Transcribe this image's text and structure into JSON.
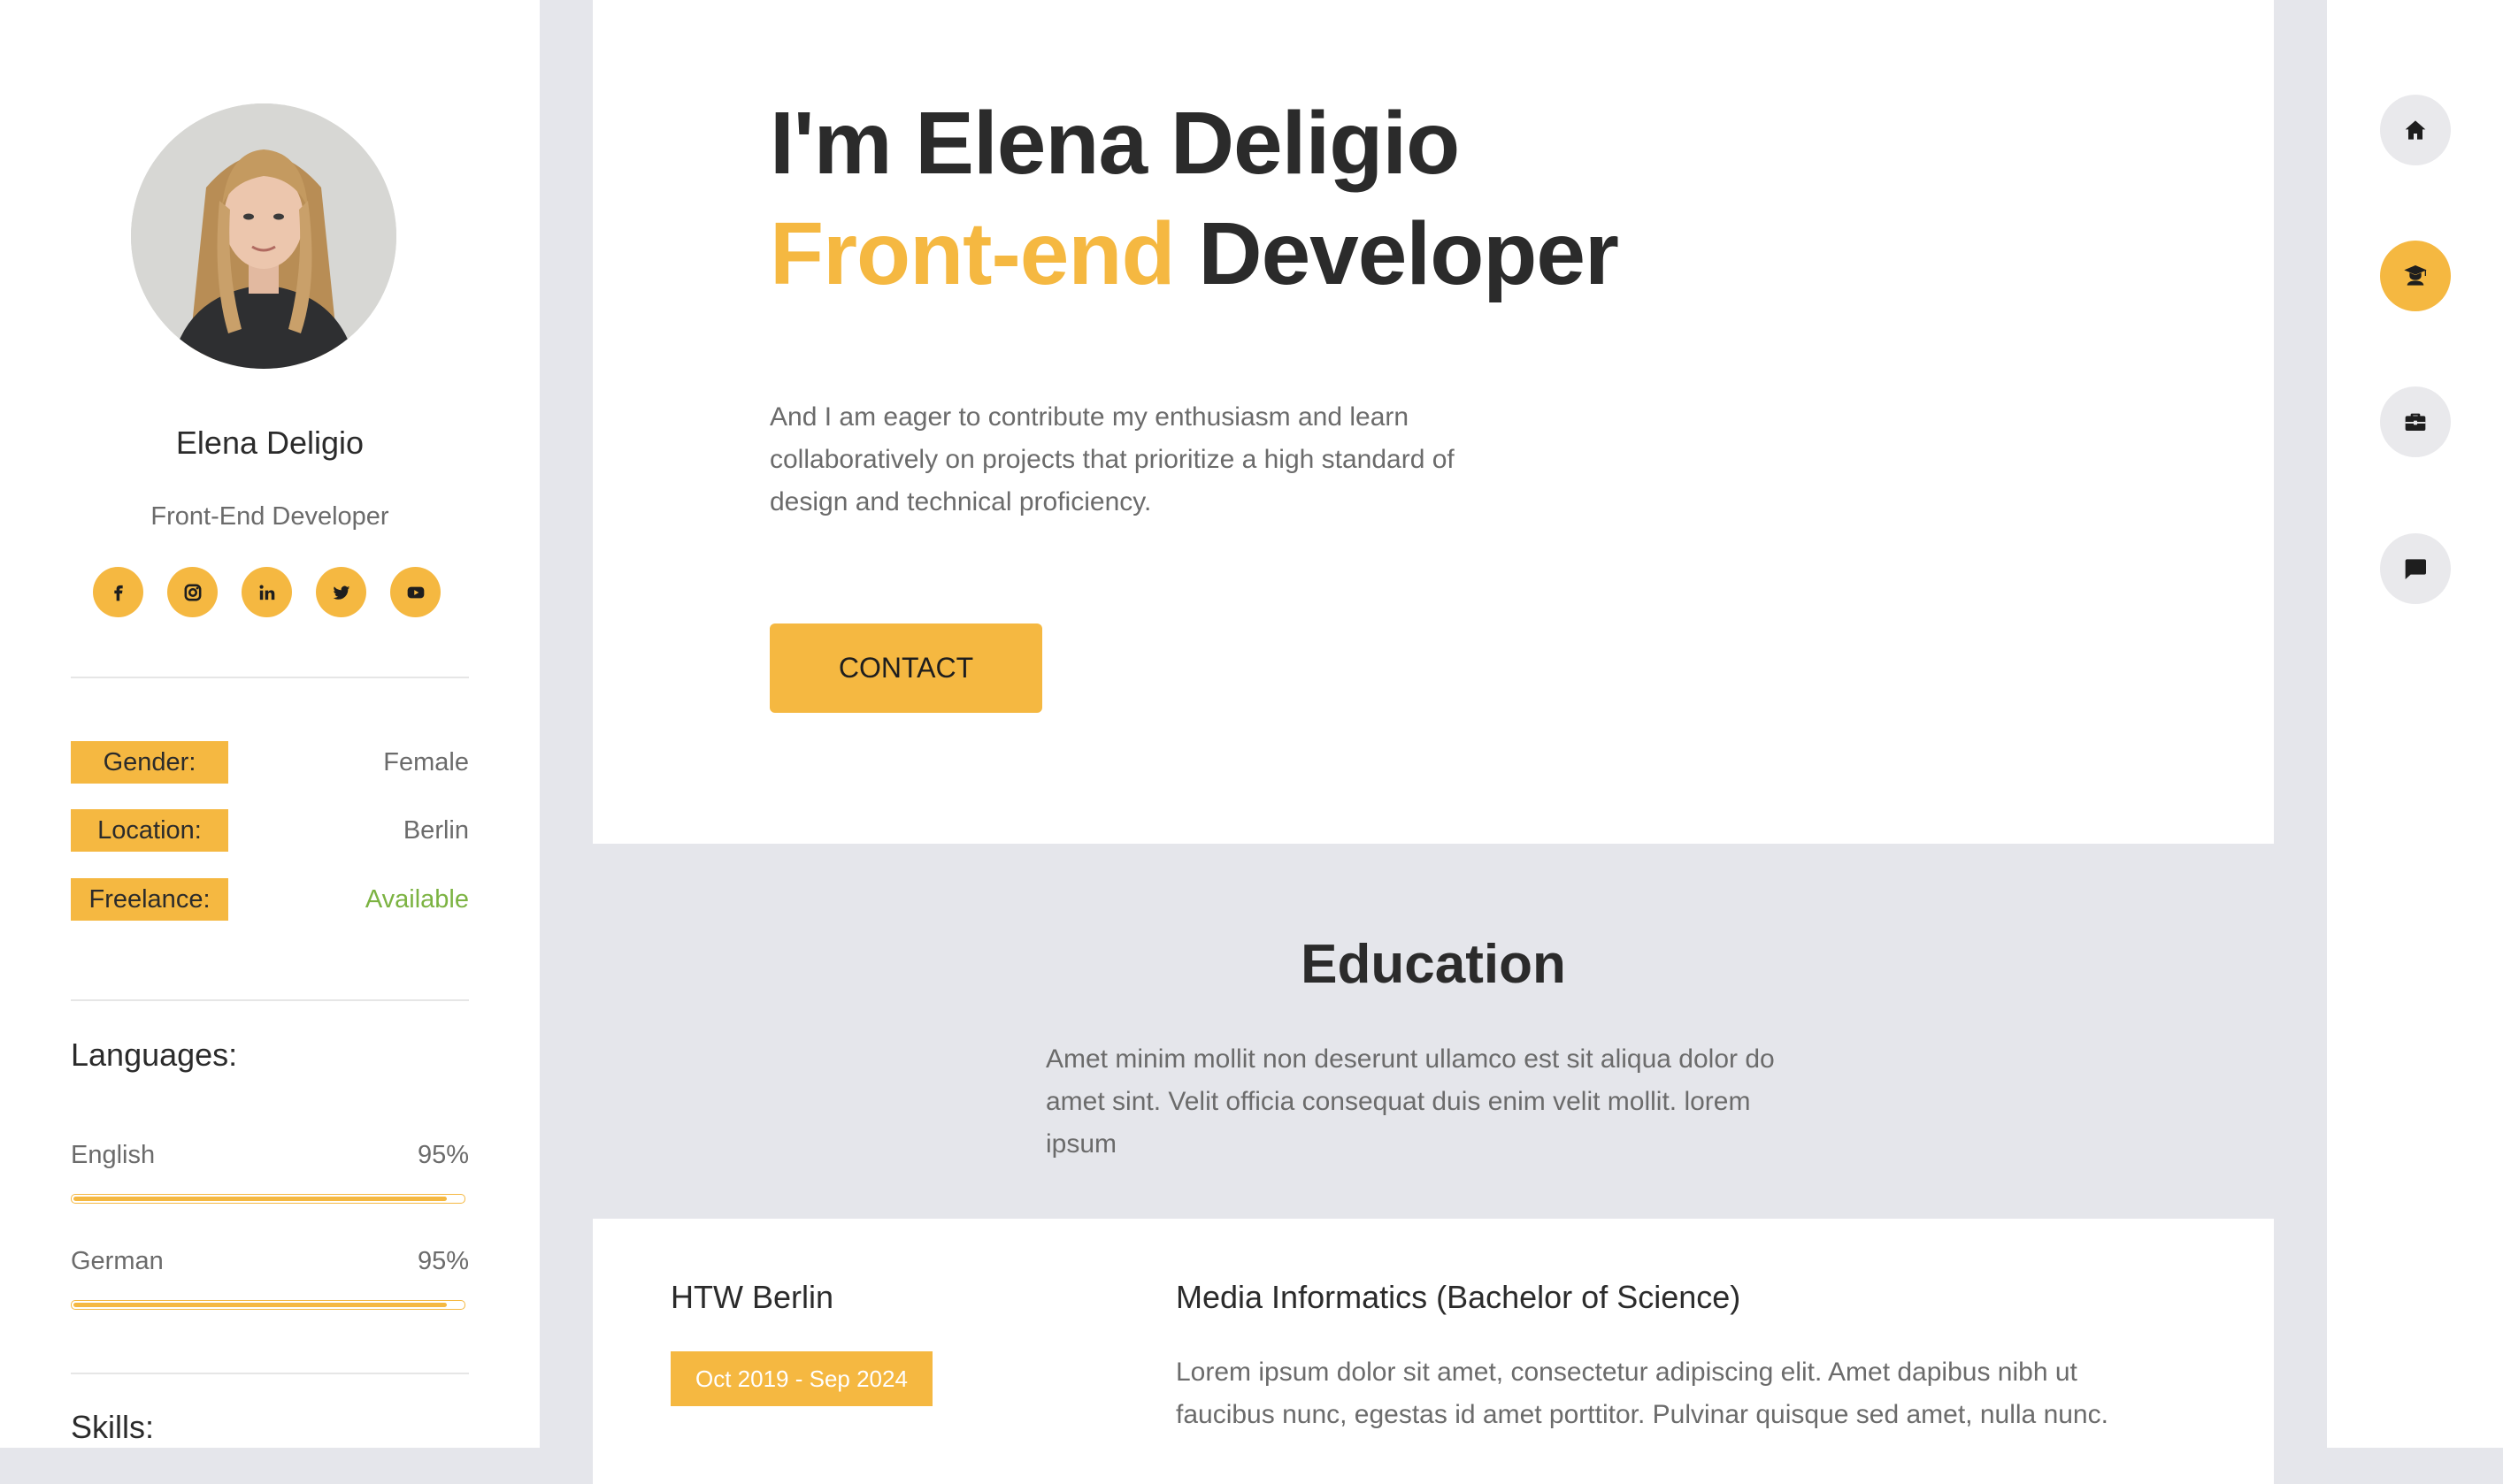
{
  "profile": {
    "name": "Elena Deligio",
    "role": "Front-End Developer",
    "socials": [
      {
        "icon": "facebook-icon"
      },
      {
        "icon": "instagram-icon"
      },
      {
        "icon": "linkedin-icon"
      },
      {
        "icon": "twitter-icon"
      },
      {
        "icon": "youtube-icon"
      }
    ],
    "info": [
      {
        "label": "Gender:",
        "value": "Female"
      },
      {
        "label": "Location:",
        "value": "Berlin"
      },
      {
        "label": "Freelance:",
        "value": "Available"
      }
    ],
    "languages_title": "Languages:",
    "languages": [
      {
        "name": "English",
        "percent_label": "95%",
        "level": 0.95
      },
      {
        "name": "German",
        "percent_label": "95%",
        "level": 0.95
      }
    ],
    "skills_title": "Skills:"
  },
  "hero": {
    "line1": "I'm Elena Deligio",
    "line2_accent": "Front-end",
    "line2_rest": " Developer",
    "description": "And I am eager to contribute my enthusiasm and learn collaboratively on projects that prioritize a high standard of design and technical proficiency.",
    "contact_label": "CONTACT"
  },
  "education": {
    "title": "Education",
    "description": "Amet minim mollit non deserunt ullamco est sit aliqua dolor do amet sint. Velit officia consequat duis enim velit mollit. lorem ipsum",
    "entries": [
      {
        "school": "HTW Berlin",
        "dates": "Oct 2019 - Sep 2024",
        "degree": "Media Informatics (Bachelor of Science)",
        "text": "Lorem ipsum dolor sit amet, consectetur adipiscing elit. Amet dapibus nibh ut faucibus nunc, egestas id amet porttitor. Pulvinar quisque sed amet, nulla nunc."
      }
    ]
  },
  "nav": [
    {
      "icon": "home-icon",
      "active": false
    },
    {
      "icon": "graduation-icon",
      "active": true
    },
    {
      "icon": "briefcase-icon",
      "active": false
    },
    {
      "icon": "chat-icon",
      "active": false
    }
  ],
  "colors": {
    "accent": "#f5b841",
    "available": "#7cb342",
    "background": "#e5e6eb"
  }
}
